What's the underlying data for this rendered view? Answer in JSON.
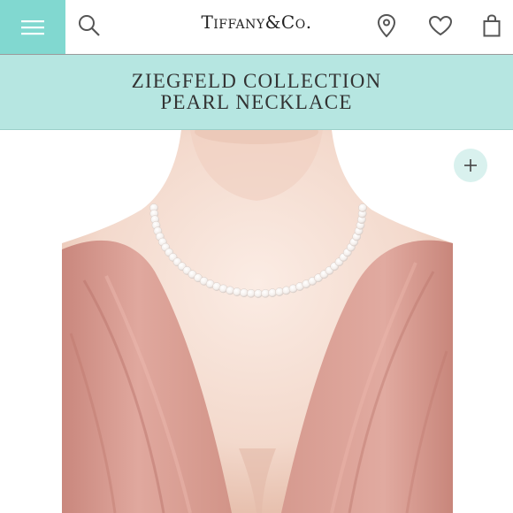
{
  "header": {
    "logo_text": "Tiffany&Co.",
    "menu_icon": "hamburger-menu-icon",
    "search_icon": "search-icon",
    "location_icon": "map-pin-icon",
    "wishlist_icon": "heart-icon",
    "bag_icon": "shopping-bag-icon"
  },
  "product": {
    "title_line1": "ZIEGFELD COLLECTION",
    "title_line2": "PEARL NECKLACE"
  },
  "gallery": {
    "zoom_icon": "plus-icon"
  },
  "colors": {
    "brand": "#81d8d0",
    "title_band": "#b6e6e1",
    "dress": "#d99c92",
    "skin": "#f6e1d6"
  }
}
